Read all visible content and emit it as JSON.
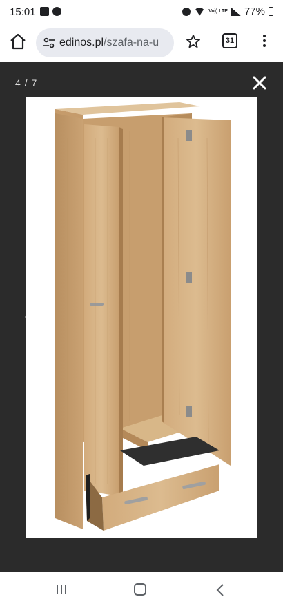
{
  "status_bar": {
    "time": "15:01",
    "volte_label": "Vo)) LTE",
    "battery": "77%"
  },
  "browser": {
    "url_domain": "edinos.pl",
    "url_path": "/szafa-na-u",
    "tab_count": "31"
  },
  "viewer": {
    "counter": "4 / 7",
    "image_subject": "wooden wardrobe with open door and drawer",
    "colors": {
      "backdrop": "#2b2b2b",
      "wood": "#cfa87a",
      "wood_dark": "#b58d5e",
      "wood_light": "#dcbd92"
    }
  },
  "icons": [
    "home-icon",
    "tune-icon",
    "star-icon",
    "tabs-icon",
    "more-vert-icon",
    "close-icon",
    "chevron-left-icon",
    "chevron-right-icon",
    "recent-apps-icon",
    "home-circle-icon",
    "back-icon"
  ]
}
